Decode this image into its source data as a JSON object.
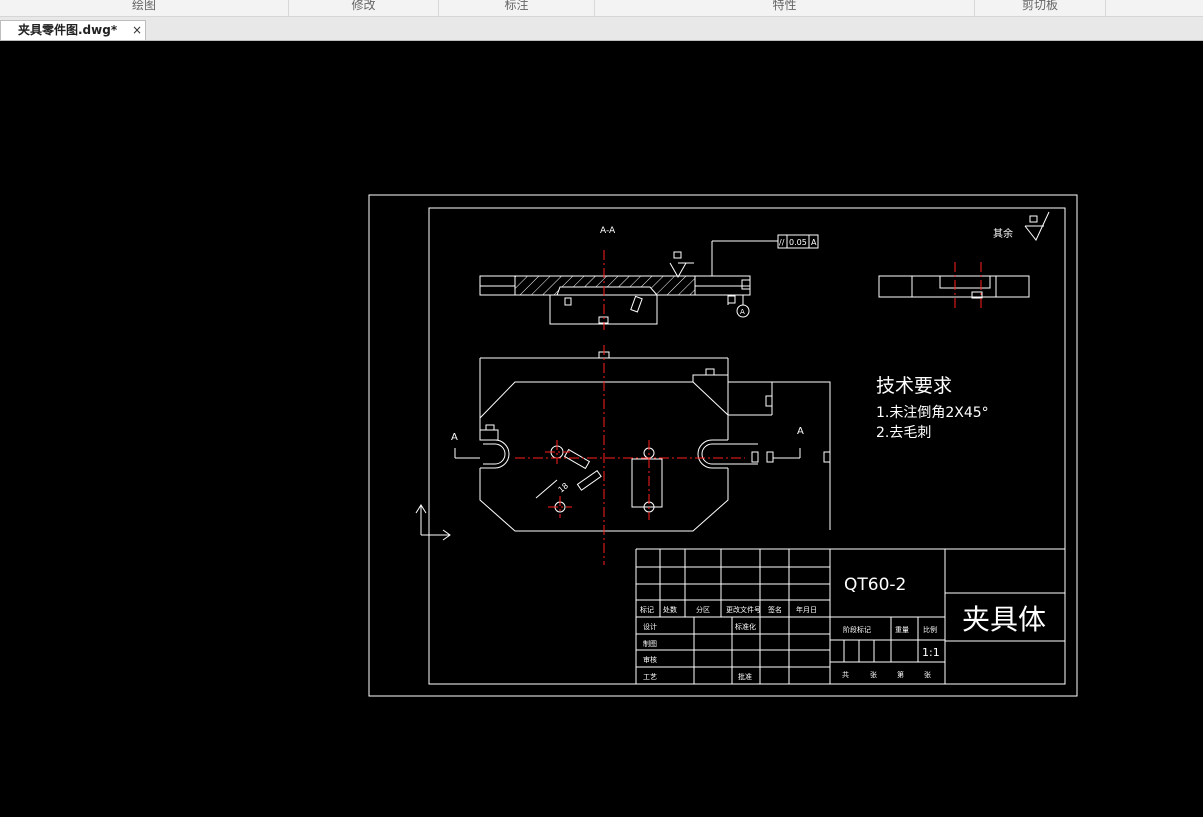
{
  "ribbon": {
    "groups": [
      "绘图",
      "修改",
      "标注",
      "特性",
      "剪切板"
    ]
  },
  "document_tab": {
    "title": "夹具零件图.dwg*",
    "close": "×"
  },
  "drawing": {
    "section_label": "A-A",
    "tolerance_symbol": "//",
    "tolerance_value": "0.05",
    "tolerance_datum": "A",
    "datum_circle": "A",
    "rest_roughness": "其余",
    "cut_label_left": "A",
    "cut_label_right": "A",
    "angle_dim": "18",
    "tech_req_title": "技术要求",
    "tech_req_1": "1.未注倒角2X45°",
    "tech_req_2": "2.去毛刺",
    "title_block": {
      "row_labels": [
        "标记",
        "处数",
        "分区",
        "更改文件号",
        "签名",
        "年月日"
      ],
      "design": "设计",
      "standardization": "标准化",
      "drawing": "制图",
      "review": "审核",
      "process": "工艺",
      "approve": "批准",
      "stage_mark": "阶段标记",
      "weight": "重量",
      "scale_label": "比例",
      "scale": "1:1",
      "sheet_total": "共",
      "sheet_unit": "张",
      "sheet_no": "第",
      "sheet_unit2": "张",
      "material": "QT60-2",
      "part_name": "夹具体"
    }
  },
  "colors": {
    "background": "#000000",
    "line": "#ffffff",
    "centerline": "#ff2020"
  }
}
